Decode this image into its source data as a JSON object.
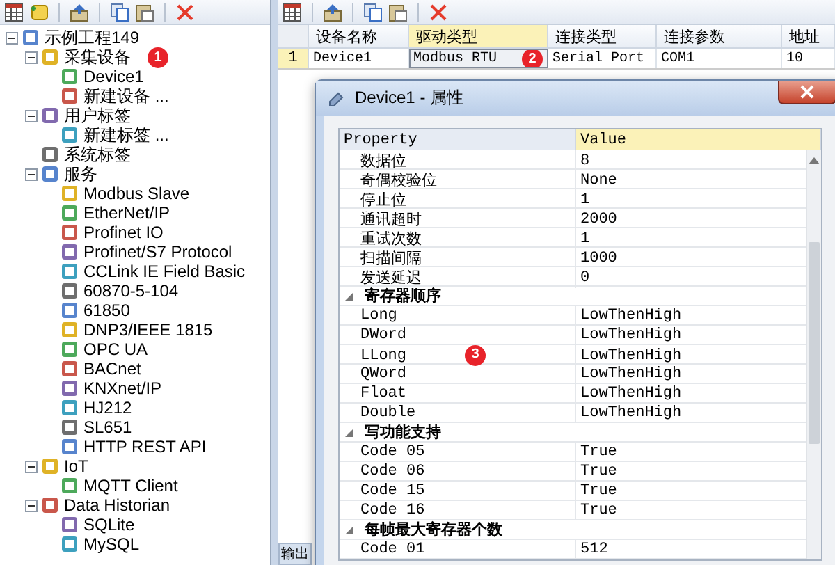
{
  "tree": {
    "items": [
      {
        "label": "示例工程149",
        "expanded": true,
        "children": [
          {
            "label": "采集设备",
            "badge": "1",
            "expanded": true,
            "children": [
              {
                "label": "Device1"
              },
              {
                "label": "新建设备 ..."
              }
            ]
          },
          {
            "label": "用户标签",
            "expanded": true,
            "children": [
              {
                "label": "新建标签 ..."
              }
            ]
          },
          {
            "label": "系统标签"
          },
          {
            "label": "服务",
            "expanded": true,
            "children": [
              {
                "label": "Modbus Slave"
              },
              {
                "label": "EtherNet/IP"
              },
              {
                "label": "Profinet IO"
              },
              {
                "label": "Profinet/S7 Protocol"
              },
              {
                "label": "CCLink IE Field Basic"
              },
              {
                "label": "60870-5-104"
              },
              {
                "label": "61850"
              },
              {
                "label": "DNP3/IEEE 1815"
              },
              {
                "label": "OPC UA"
              },
              {
                "label": "BACnet"
              },
              {
                "label": "KNXnet/IP"
              },
              {
                "label": "HJ212"
              },
              {
                "label": "SL651"
              },
              {
                "label": "HTTP REST API"
              }
            ]
          },
          {
            "label": "IoT",
            "expanded": true,
            "children": [
              {
                "label": "MQTT Client"
              }
            ]
          },
          {
            "label": "Data Historian",
            "expanded": true,
            "children": [
              {
                "label": "SQLite"
              },
              {
                "label": "MySQL"
              }
            ]
          }
        ]
      }
    ]
  },
  "device_table": {
    "columns": [
      {
        "label": "设备名称",
        "selected": false
      },
      {
        "label": "驱动类型",
        "selected": true
      },
      {
        "label": "连接类型",
        "selected": false
      },
      {
        "label": "连接参数",
        "selected": false
      },
      {
        "label": "地址",
        "selected": false
      }
    ],
    "rows": [
      {
        "index": "1",
        "cells": [
          "Device1",
          "Modbus RTU",
          "Serial Port",
          "COM1",
          "10"
        ],
        "badge": "2"
      }
    ]
  },
  "output_tab": {
    "label": "输出"
  },
  "dialog": {
    "title": "Device1 - 属性",
    "property_grid": {
      "columns": [
        "Property",
        "Value"
      ],
      "rows": [
        {
          "kind": "property",
          "name": "数据位",
          "value": "8"
        },
        {
          "kind": "property",
          "name": "奇偶校验位",
          "value": "None"
        },
        {
          "kind": "property",
          "name": "停止位",
          "value": "1"
        },
        {
          "kind": "property",
          "name": "通讯超时",
          "value": "2000"
        },
        {
          "kind": "property",
          "name": "重试次数",
          "value": "1"
        },
        {
          "kind": "property",
          "name": "扫描间隔",
          "value": "1000"
        },
        {
          "kind": "property",
          "name": "发送延迟",
          "value": "0"
        },
        {
          "kind": "category",
          "name": "寄存器顺序",
          "expanded": true
        },
        {
          "kind": "property",
          "name": "Long",
          "value": "LowThenHigh"
        },
        {
          "kind": "property",
          "name": "DWord",
          "value": "LowThenHigh"
        },
        {
          "kind": "property",
          "name": "LLong",
          "value": "LowThenHigh",
          "badge": "3"
        },
        {
          "kind": "property",
          "name": "QWord",
          "value": "LowThenHigh"
        },
        {
          "kind": "property",
          "name": "Float",
          "value": "LowThenHigh"
        },
        {
          "kind": "property",
          "name": "Double",
          "value": "LowThenHigh"
        },
        {
          "kind": "category",
          "name": "写功能支持",
          "expanded": true
        },
        {
          "kind": "property",
          "name": "Code 05",
          "value": "True"
        },
        {
          "kind": "property",
          "name": "Code 06",
          "value": "True"
        },
        {
          "kind": "property",
          "name": "Code 15",
          "value": "True"
        },
        {
          "kind": "property",
          "name": "Code 16",
          "value": "True"
        },
        {
          "kind": "category",
          "name": "每帧最大寄存器个数",
          "expanded": true
        },
        {
          "kind": "property",
          "name": "Code 01",
          "value": "512"
        }
      ]
    }
  }
}
